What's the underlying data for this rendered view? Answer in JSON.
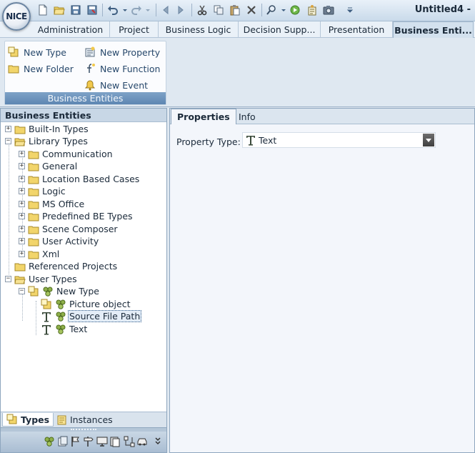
{
  "app": {
    "logo_text": "NICE",
    "window_title": "Untitled4 -"
  },
  "quick_access": [
    {
      "icon": "new-document-icon"
    },
    {
      "icon": "open-folder-icon"
    },
    {
      "icon": "save-icon"
    },
    {
      "icon": "save-as-icon"
    },
    {
      "icon": "undo-icon"
    },
    {
      "icon": "redo-icon"
    },
    {
      "icon": "back-arrow-icon"
    },
    {
      "icon": "forward-arrow-icon"
    },
    {
      "icon": "cut-icon"
    },
    {
      "icon": "copy-icon"
    },
    {
      "icon": "paste-icon"
    },
    {
      "icon": "delete-icon"
    },
    {
      "icon": "search-icon"
    },
    {
      "icon": "run-icon"
    },
    {
      "icon": "build-icon"
    },
    {
      "icon": "camera-icon"
    },
    {
      "icon": "customize-dropdown-icon"
    }
  ],
  "ribbon_tabs": [
    {
      "label": "Administration"
    },
    {
      "label": "Project"
    },
    {
      "label": "Business Logic"
    },
    {
      "label": "Decision Supp..."
    },
    {
      "label": "Presentation"
    },
    {
      "label": "Business Enti..."
    }
  ],
  "ribbon_group": {
    "caption": "Business Entities",
    "buttons": {
      "new_type": "New Type",
      "new_folder": "New Folder",
      "new_property": "New Property",
      "new_function": "New Function",
      "new_event": "New Event"
    }
  },
  "left_panel": {
    "header": "Business Entities",
    "tree": [
      {
        "label": "Built-In Types"
      },
      {
        "label": "Library Types"
      },
      {
        "label": "Communication"
      },
      {
        "label": "General"
      },
      {
        "label": "Location Based Cases"
      },
      {
        "label": "Logic"
      },
      {
        "label": "MS Office"
      },
      {
        "label": "Predefined BE Types"
      },
      {
        "label": "Scene Composer"
      },
      {
        "label": "User Activity"
      },
      {
        "label": "Xml"
      },
      {
        "label": "Referenced Projects"
      },
      {
        "label": "User Types"
      },
      {
        "label": "New Type"
      },
      {
        "label": "Picture object"
      },
      {
        "label": "Source File Path"
      },
      {
        "label": "Text"
      }
    ],
    "tabs": {
      "types": "Types",
      "instances": "Instances"
    }
  },
  "right_panel": {
    "tabs": {
      "properties": "Properties",
      "info": "Info"
    },
    "property_type_label": "Property Type:",
    "property_type_value": "Text"
  },
  "colors": {
    "accent": "#5d86b2",
    "selection": "#e4edf7",
    "folder": "#f2d56b"
  }
}
